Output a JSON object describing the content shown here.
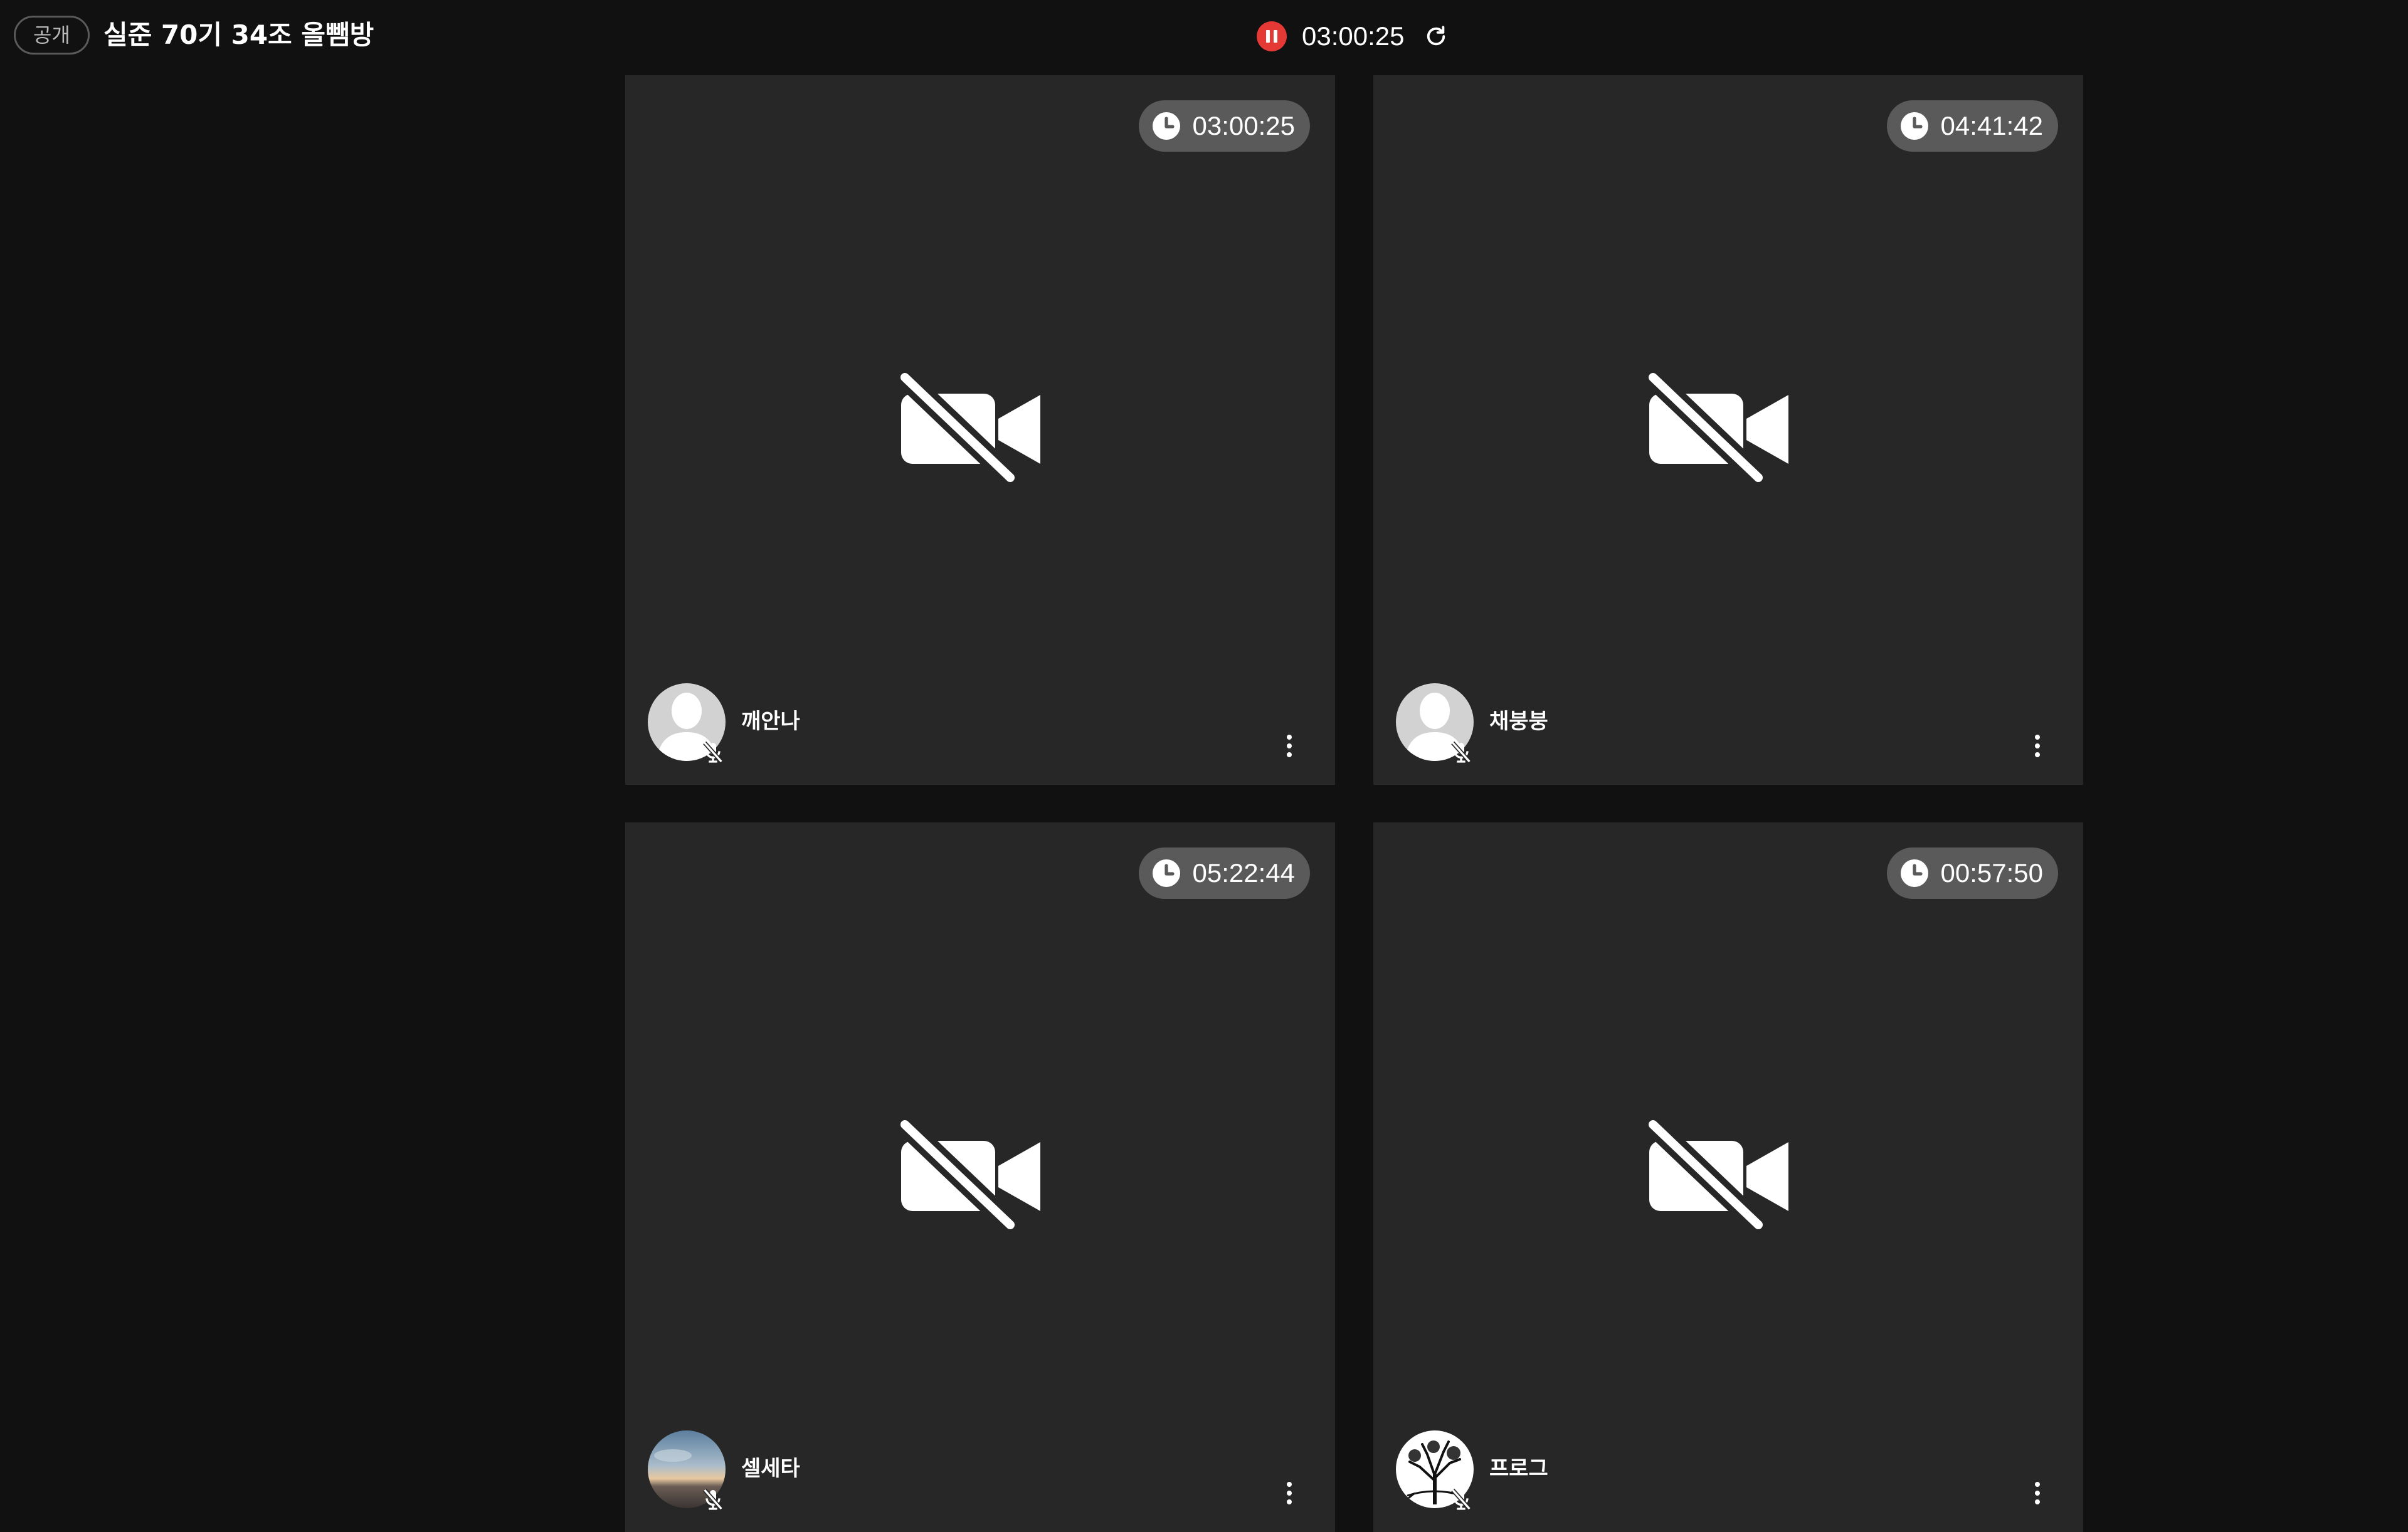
{
  "header": {
    "visibility_badge": "공개",
    "room_title": "실준 70기 34조 올뺌방",
    "elapsed_time": "03:00:25",
    "recording_color": "#e53935"
  },
  "tiles": [
    {
      "name": "깨안나",
      "study_time": "03:00:25",
      "avatar": "default-silhouette",
      "camera": "off",
      "mic": "off"
    },
    {
      "name": "채붕붕",
      "study_time": "04:41:42",
      "avatar": "default-silhouette",
      "camera": "off",
      "mic": "off"
    },
    {
      "name": "셀세타",
      "study_time": "05:22:44",
      "avatar": "sunset-photo",
      "camera": "off",
      "mic": "off"
    },
    {
      "name": "프로그",
      "study_time": "00:57:50",
      "avatar": "tree-sketch",
      "camera": "off",
      "mic": "off"
    }
  ],
  "icons": {
    "pause": "pause-icon",
    "refresh": "refresh-icon",
    "clock": "clock-icon",
    "camera_off": "camera-off-icon",
    "mic_off": "mic-off-icon",
    "more": "more-vertical-icon"
  }
}
